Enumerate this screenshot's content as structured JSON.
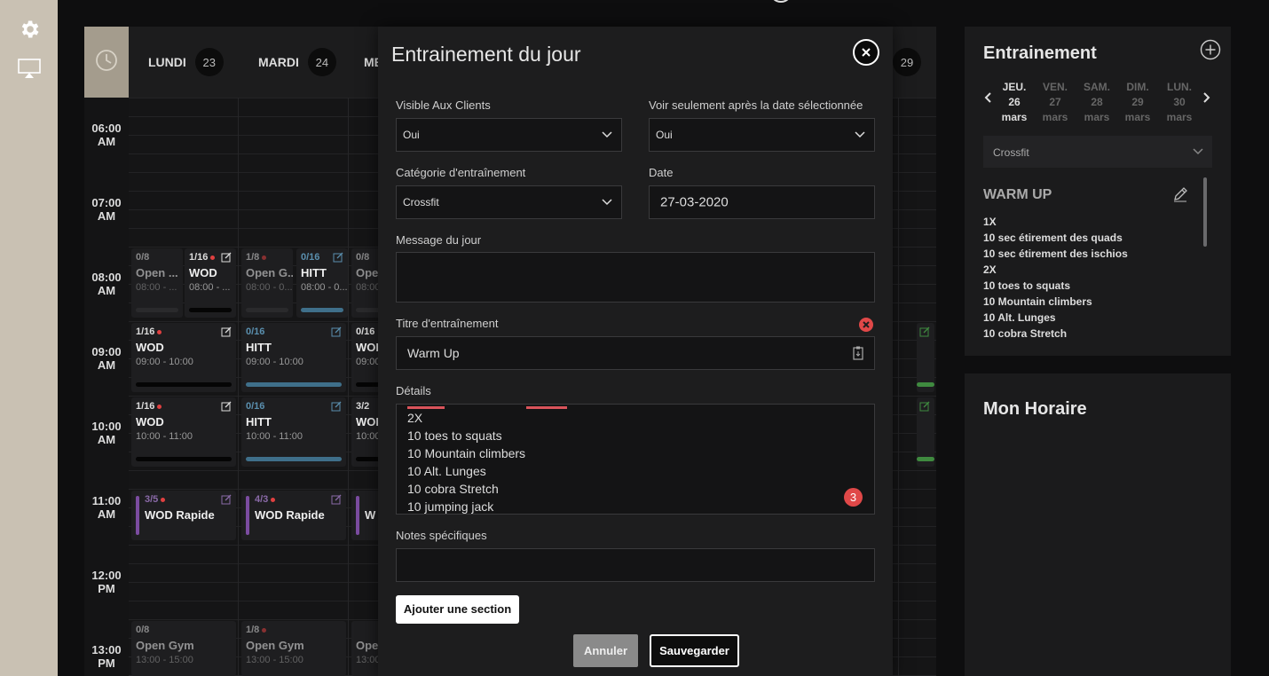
{
  "calendar": {
    "days": [
      {
        "name": "LUNDI",
        "num": "23"
      },
      {
        "name": "MARDI",
        "num": "24"
      },
      {
        "name": "ME",
        "num": ""
      },
      {
        "name": "",
        "num": "29"
      }
    ],
    "hours": [
      {
        "t": "06:00",
        "p": "AM"
      },
      {
        "t": "07:00",
        "p": "AM"
      },
      {
        "t": "08:00",
        "p": "AM"
      },
      {
        "t": "09:00",
        "p": "AM"
      },
      {
        "t": "10:00",
        "p": "AM"
      },
      {
        "t": "11:00",
        "p": "AM"
      },
      {
        "t": "12:00",
        "p": "PM"
      },
      {
        "t": "13:00",
        "p": "PM"
      }
    ],
    "events": {
      "e1": {
        "count": "0/8",
        "name": "Open ...",
        "time": "08:00 - ..."
      },
      "e2": {
        "count": "1/16",
        "name": "WOD",
        "time": "08:00 - ..."
      },
      "e3": {
        "count": "1/8",
        "name": "Open G...",
        "time": "08:00 - 0..."
      },
      "e4": {
        "count": "0/16",
        "name": "HITT",
        "time": "08:00 - 0..."
      },
      "e5": {
        "count": "0/8",
        "name": "Ope",
        "time": "08:00 -"
      },
      "e6": {
        "count": "1/16",
        "name": "WOD",
        "time": "09:00 - 10:00"
      },
      "e7": {
        "count": "0/16",
        "name": "HITT",
        "time": "09:00 - 10:00"
      },
      "e8": {
        "count": "0/16",
        "name": "WOD",
        "time": "09:00"
      },
      "e9": {
        "count": "1/16",
        "name": "WOD",
        "time": "10:00 - 11:00"
      },
      "e10": {
        "count": "0/16",
        "name": "HITT",
        "time": "10:00 - 11:00"
      },
      "e11": {
        "count": "3/2",
        "name": "WOD",
        "time": "10:00"
      },
      "e12": {
        "count": "3/5",
        "name": "WOD Rapide"
      },
      "e13": {
        "count": "4/3",
        "name": "WOD Rapide"
      },
      "e14": {
        "count": "",
        "name": "W"
      },
      "e15": {
        "count": "0/8",
        "name": "Open Gym",
        "time": "13:00 - 15:00"
      },
      "e16": {
        "count": "1/8",
        "name": "Open Gym",
        "time": "13:00 - 15:00"
      },
      "e17": {
        "count": "",
        "name": "Ope",
        "time": "13:00"
      }
    }
  },
  "modal": {
    "title": "Entrainement du jour",
    "visible_label": "Visible Aux Clients",
    "visible_value": "Oui",
    "after_label": "Voir seulement après la date sélectionnée",
    "after_value": "Oui",
    "category_label": "Catégorie d'entraînement",
    "category_value": "Crossfit",
    "date_label": "Date",
    "date_value": "27-03-2020",
    "message_label": "Message du jour",
    "message_value": "",
    "workout_title_label": "Titre d'entraînement",
    "workout_title_value": "Warm Up",
    "details_label": "Détails",
    "details_lines": [
      "2X",
      "10 toes to squats",
      "10 Mountain climbers",
      "10 Alt. Lunges",
      "10 cobra Stretch",
      "10 jumping jack"
    ],
    "details_badge": "3",
    "notes_label": "Notes spécifiques",
    "notes_value": "",
    "add_section": "Ajouter une section",
    "cancel": "Annuler",
    "save": "Sauvegarder"
  },
  "side": {
    "title": "Entrainement",
    "days": [
      {
        "d": "JEU.",
        "n": "26",
        "m": "mars"
      },
      {
        "d": "VEN.",
        "n": "27",
        "m": "mars"
      },
      {
        "d": "SAM.",
        "n": "28",
        "m": "mars"
      },
      {
        "d": "DIM.",
        "n": "29",
        "m": "mars"
      },
      {
        "d": "LUN.",
        "n": "30",
        "m": "mars"
      }
    ],
    "category": "Crossfit",
    "section_title": "WARM UP",
    "section_lines": [
      "1X",
      "10 sec étirement des quads",
      "10 sec étirement des ischios",
      "2X",
      "10 toes to squats",
      "10 Mountain climbers",
      "10 Alt. Lunges",
      "10 cobra Stretch"
    ],
    "schedule_title": "Mon Horaire"
  },
  "colors": {
    "accent_blue": "#3f6f8a",
    "accent_green": "#3f8a3f",
    "accent_purple": "#7b4ca0",
    "danger": "#e04848"
  }
}
